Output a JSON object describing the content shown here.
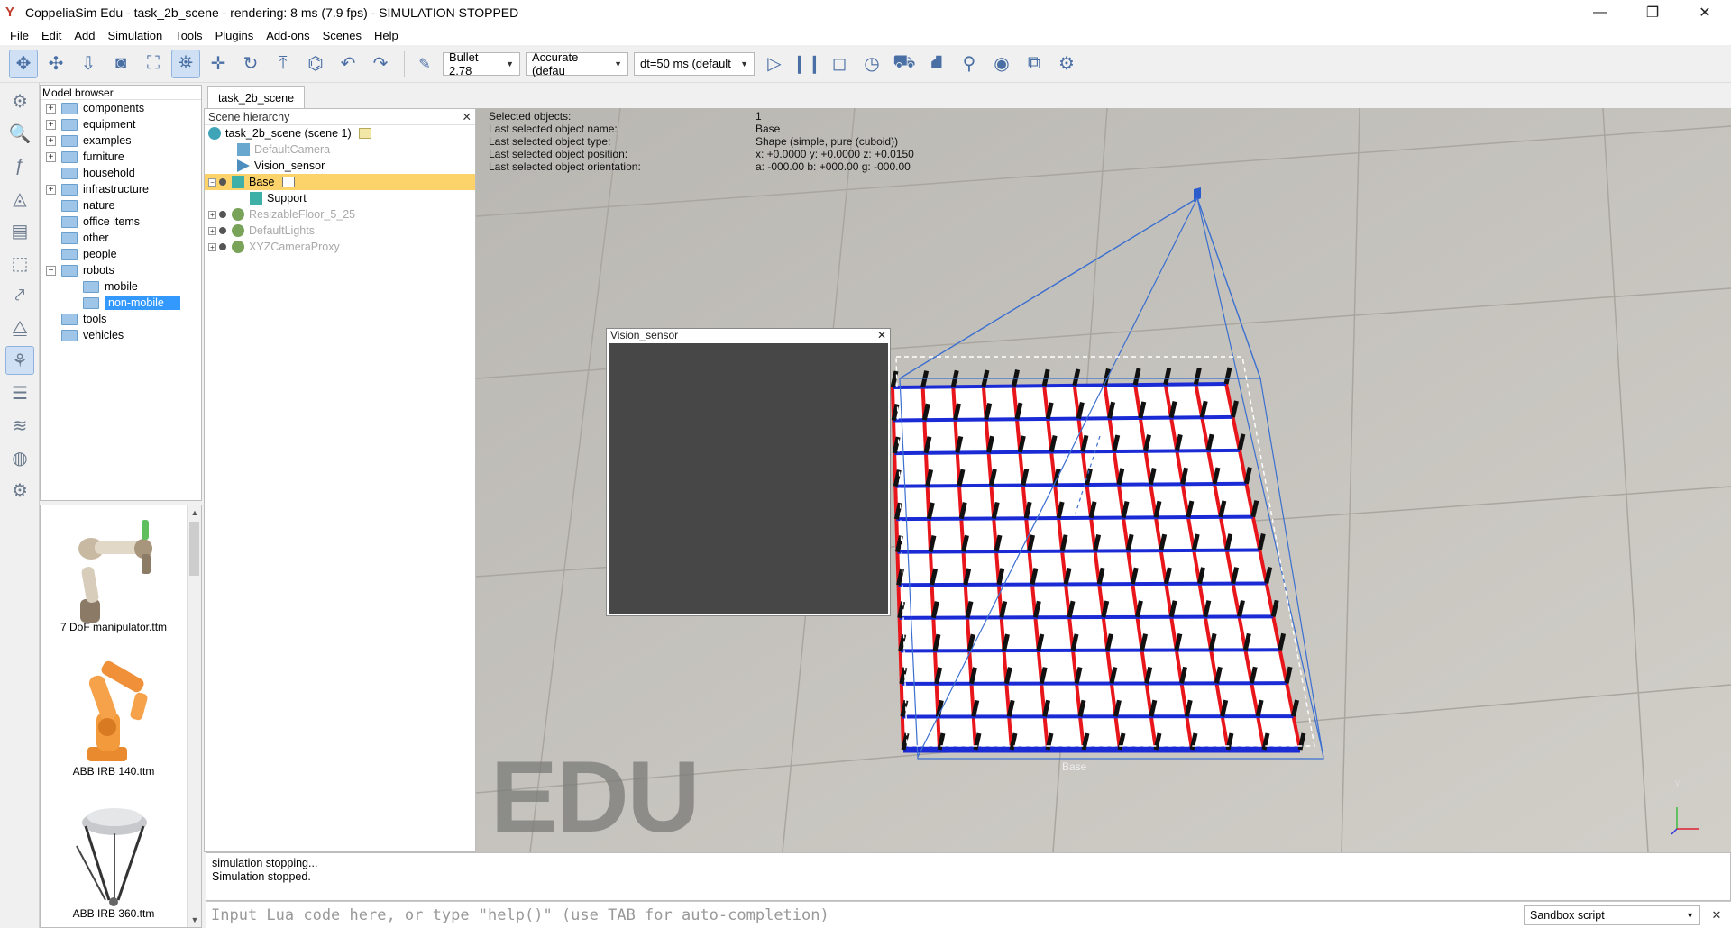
{
  "window": {
    "title": "CoppeliaSim Edu - task_2b_scene - rendering: 8 ms (7.9 fps) - SIMULATION STOPPED",
    "minimize": "—",
    "maximize": "❐",
    "close": "✕"
  },
  "menu": [
    "File",
    "Edit",
    "Add",
    "Simulation",
    "Tools",
    "Plugins",
    "Add-ons",
    "Scenes",
    "Help"
  ],
  "toolbar": {
    "engine": "Bullet 2.78",
    "accuracy": "Accurate (defau",
    "timestep": "dt=50 ms (default"
  },
  "model_browser": {
    "header": "Model browser",
    "items": [
      {
        "label": "components",
        "expandable": true
      },
      {
        "label": "equipment",
        "expandable": true
      },
      {
        "label": "examples",
        "expandable": true
      },
      {
        "label": "furniture",
        "expandable": true
      },
      {
        "label": "household",
        "expandable": false
      },
      {
        "label": "infrastructure",
        "expandable": true
      },
      {
        "label": "nature",
        "expandable": false
      },
      {
        "label": "office items",
        "expandable": false
      },
      {
        "label": "other",
        "expandable": false
      },
      {
        "label": "people",
        "expandable": false
      },
      {
        "label": "robots",
        "expandable": true
      },
      {
        "label": "mobile",
        "expandable": false
      },
      {
        "label": "non-mobile",
        "expandable": false
      },
      {
        "label": "tools",
        "expandable": false
      },
      {
        "label": "vehicles",
        "expandable": false
      }
    ],
    "thumbnails": [
      "7 DoF manipulator.ttm",
      "ABB IRB 140.ttm",
      "ABB IRB 360.ttm"
    ]
  },
  "scene_tab": "task_2b_scene",
  "hierarchy": {
    "header": "Scene hierarchy",
    "close": "✕",
    "rows": [
      "task_2b_scene (scene 1)",
      "DefaultCamera",
      "Vision_sensor",
      "Base",
      "Support",
      "ResizableFloor_5_25",
      "DefaultLights",
      "XYZCameraProxy"
    ]
  },
  "info": {
    "rows": [
      {
        "k": "Selected objects:",
        "v": "1"
      },
      {
        "k": "Last selected object name:",
        "v": "Base"
      },
      {
        "k": "Last selected object type:",
        "v": "Shape (simple, pure (cuboid))"
      },
      {
        "k": "Last selected object position:",
        "v": "x: +0.0000    y: +0.0000    z: +0.0150"
      },
      {
        "k": "Last selected object orientation:",
        "v": "a: -000.00    b: +000.00    g: -000.00"
      }
    ]
  },
  "vision_window": {
    "title": "Vision_sensor",
    "close": "✕"
  },
  "viewport": {
    "watermark": "EDU",
    "object_label": "Base",
    "axis_label": "y"
  },
  "console": {
    "lines": [
      "simulation stopping...",
      "Simulation stopped."
    ]
  },
  "lua": {
    "placeholder": "Input Lua code here, or type \"help()\" (use TAB for auto-completion)",
    "script_type": "Sandbox script",
    "close": "✕"
  },
  "colors": {
    "selection_highlight": "#fcd36a",
    "tree_selected": "#3399ff",
    "grid_red": "#e8151b",
    "grid_blue": "#1a2bd6",
    "pillar": "#111111"
  }
}
